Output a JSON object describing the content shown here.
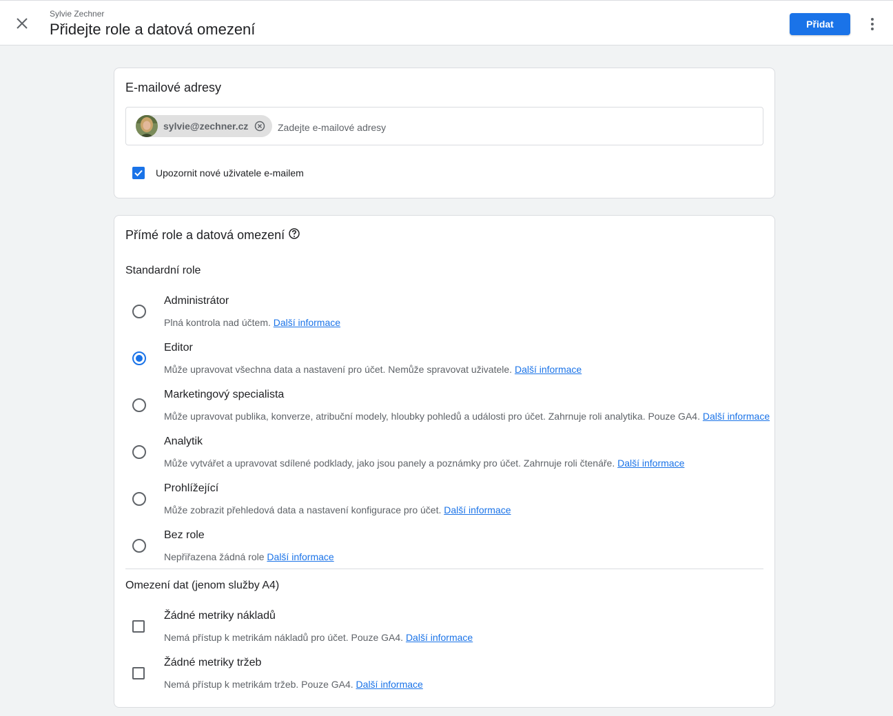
{
  "header": {
    "subtitle": "Sylvie Zechner",
    "title": "Přidejte role a datová omezení",
    "primary_button": "Přidat"
  },
  "email_section": {
    "title": "E-mailové adresy",
    "chip_email": "sylvie@zechner.cz",
    "input_placeholder": "Zadejte e-mailové adresy",
    "notify_label": "Upozornit nové uživatele e-mailem",
    "notify_checked": true
  },
  "roles_section": {
    "title": "Přímé role a datová omezení",
    "standard_heading": "Standardní role",
    "learn_more": "Další informace",
    "roles": [
      {
        "title": "Administrátor",
        "desc": "Plná kontrola nad účtem.",
        "selected": false
      },
      {
        "title": "Editor",
        "desc": "Může upravovat všechna data a nastavení pro účet. Nemůže spravovat uživatele.",
        "selected": true
      },
      {
        "title": "Marketingový specialista",
        "desc": "Může upravovat publika, konverze, atribuční modely, hloubky pohledů a události pro účet. Zahrnuje roli analytika. Pouze GA4.",
        "selected": false
      },
      {
        "title": "Analytik",
        "desc": "Může vytvářet a upravovat sdílené podklady, jako jsou panely a poznámky pro účet. Zahrnuje roli čtenáře.",
        "selected": false
      },
      {
        "title": "Prohlížející",
        "desc": "Může zobrazit přehledová data a nastavení konfigurace pro účet.",
        "selected": false
      },
      {
        "title": "Bez role",
        "desc": "Nepřiřazena žádná role",
        "selected": false
      }
    ],
    "data_heading": "Omezení dat (jenom služby A4)",
    "data_restrictions": [
      {
        "title": "Žádné metriky nákladů",
        "desc": "Nemá přístup k metrikám nákladů pro účet. Pouze GA4.",
        "checked": false
      },
      {
        "title": "Žádné metriky tržeb",
        "desc": "Nemá přístup k metrikám tržeb. Pouze GA4.",
        "checked": false
      }
    ]
  },
  "colors": {
    "accent": "#1a73e8",
    "background": "#f1f3f4",
    "border": "#dadce0",
    "text_secondary": "#5f6368"
  }
}
